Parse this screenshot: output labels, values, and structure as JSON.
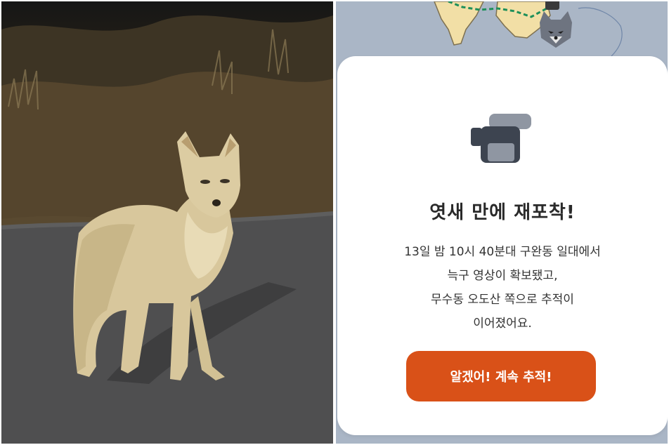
{
  "dialog": {
    "title": "엿새 만에 재포착!",
    "lines": [
      "13일 밤 10시 40분대 구완동 일대에서",
      "늑구 영상이 확보됐고,",
      "무수동 오도산 쪽으로 추적이",
      "이어졌어요."
    ],
    "confirm_label": "알겠어! 계속 추적!"
  },
  "colors": {
    "accent": "#d95118",
    "map_background": "#aab6c6",
    "map_land": "#f2dfa6"
  },
  "icons": {
    "camera": "video-camera-icon",
    "wolf_marker": "wolf-face-icon"
  }
}
